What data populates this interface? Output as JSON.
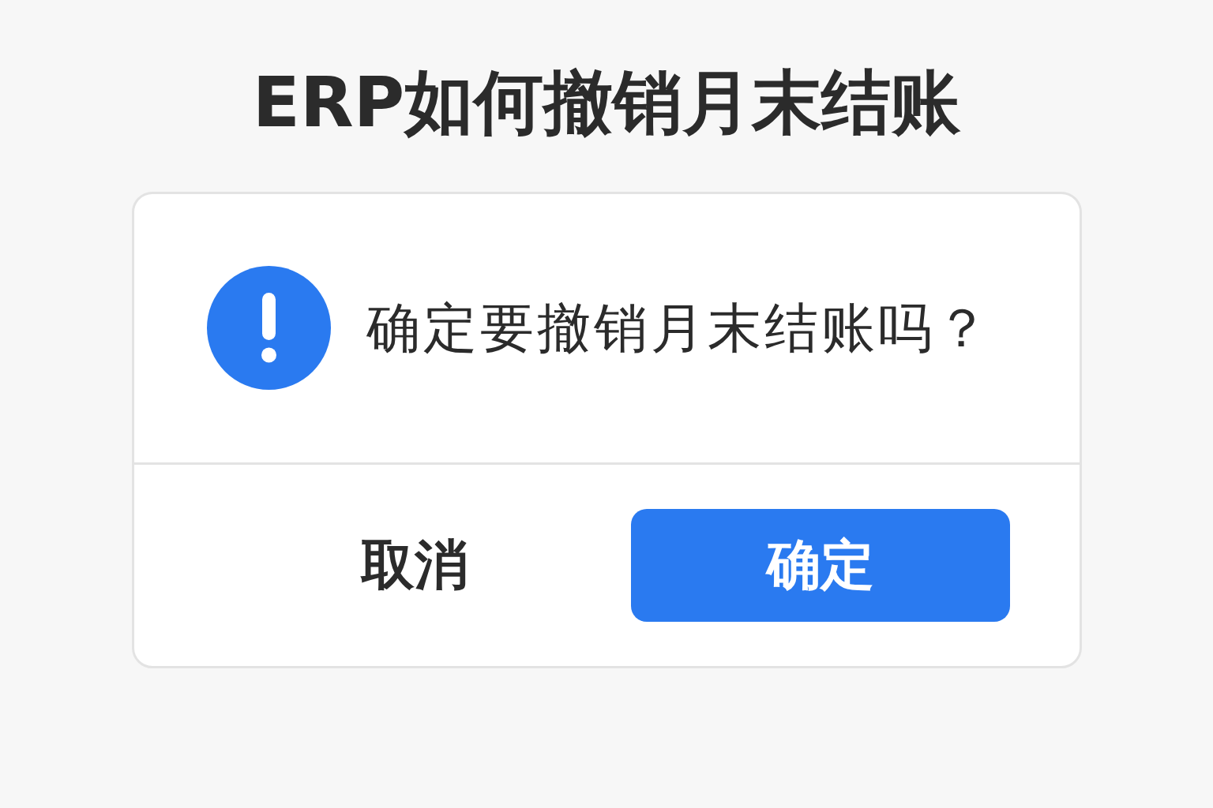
{
  "title": "ERP如何撤销月末结账",
  "dialog": {
    "message": "确定要撤销月末结账吗？",
    "buttons": [
      {
        "label": "取消",
        "kind": "secondary"
      },
      {
        "label": "确定",
        "kind": "primary"
      }
    ]
  }
}
